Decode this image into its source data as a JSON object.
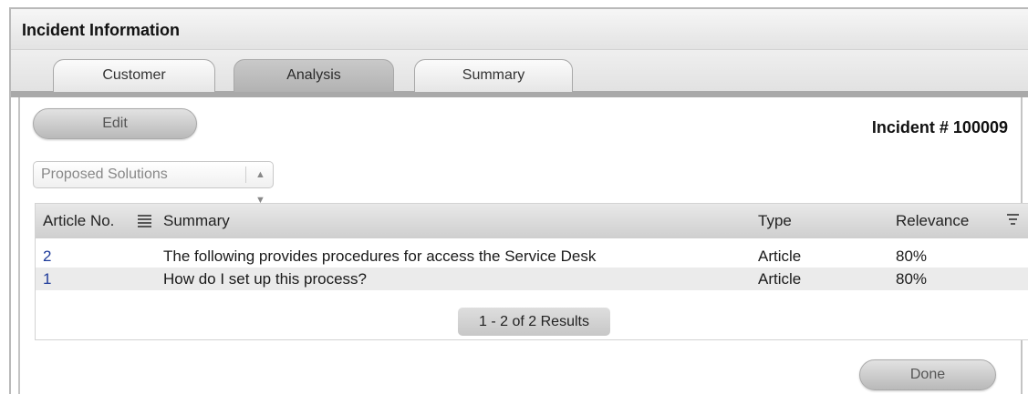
{
  "panel": {
    "title": "Incident Information"
  },
  "tabs": [
    {
      "label": "Customer"
    },
    {
      "label": "Analysis"
    },
    {
      "label": "Summary"
    }
  ],
  "toolbar": {
    "edit_label": "Edit"
  },
  "incident": {
    "number_label": "Incident # 100009"
  },
  "solutions_select": {
    "value": "Proposed Solutions"
  },
  "table": {
    "columns": [
      "Article No.",
      "Summary",
      "Type",
      "Relevance"
    ],
    "rows": [
      {
        "article_no": "2",
        "summary": "The following provides procedures for access the Service Desk",
        "type": "Article",
        "relevance": "80%"
      },
      {
        "article_no": "1",
        "summary": "How do I set up this process?",
        "type": "Article",
        "relevance": "80%"
      }
    ],
    "pagination": "1 - 2 of 2 Results"
  },
  "footer": {
    "done_label": "Done"
  }
}
